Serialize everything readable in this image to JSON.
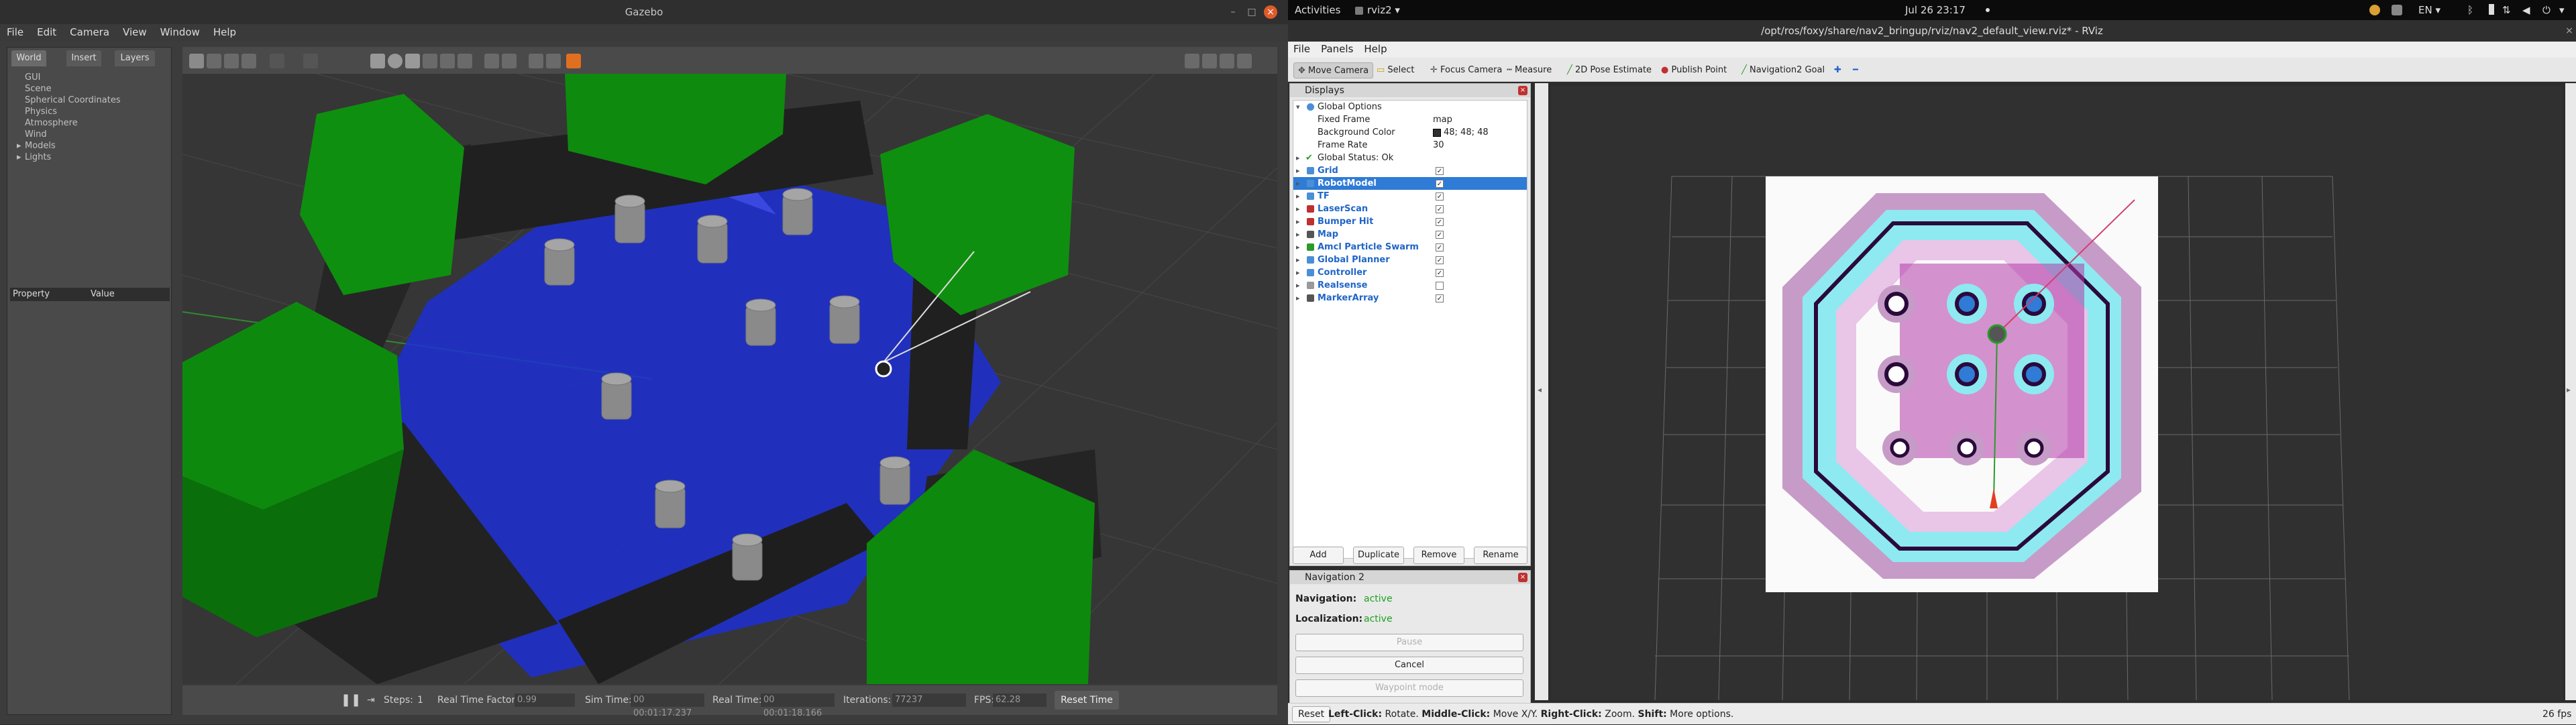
{
  "gazebo": {
    "title": "Gazebo",
    "menu": [
      "File",
      "Edit",
      "Camera",
      "View",
      "Window",
      "Help"
    ],
    "tabs": [
      "World",
      "Insert",
      "Layers"
    ],
    "tree": [
      "GUI",
      "Scene",
      "Spherical Coordinates",
      "Physics",
      "Atmosphere",
      "Wind",
      "Models",
      "Lights"
    ],
    "property_header": {
      "property": "Property",
      "value": "Value"
    },
    "bottom": {
      "steps_label": "Steps:",
      "steps_value": "1",
      "rtf_label": "Real Time Factor:",
      "rtf_value": "0.99",
      "sim_label": "Sim Time:",
      "sim_value": "00 00:01:17.237",
      "real_label": "Real Time:",
      "real_value": "00 00:01:18.166",
      "iter_label": "Iterations:",
      "iter_value": "77237",
      "fps_label": "FPS:",
      "fps_value": "62.28",
      "reset_label": "Reset Time"
    }
  },
  "topbar": {
    "activities": "Activities",
    "app": "rviz2 ▾",
    "clock": "Jul 26  23:17",
    "lang": "EN ▾"
  },
  "rviz": {
    "title": "/opt/ros/foxy/share/nav2_bringup/rviz/nav2_default_view.rviz* - RViz",
    "menu": [
      "File",
      "Panels",
      "Help"
    ],
    "tools": [
      "Move Camera",
      "Select",
      "Focus Camera",
      "Measure",
      "2D Pose Estimate",
      "Publish Point",
      "Navigation2 Goal"
    ],
    "displays_title": "Displays",
    "global_options": "Global Options",
    "fixed_frame": {
      "label": "Fixed Frame",
      "value": "map"
    },
    "bg_color": {
      "label": "Background Color",
      "value": "48; 48; 48"
    },
    "frame_rate": {
      "label": "Frame Rate",
      "value": "30"
    },
    "global_status": "Global Status: Ok",
    "plugins": [
      {
        "name": "Grid",
        "checked": true
      },
      {
        "name": "RobotModel",
        "checked": true
      },
      {
        "name": "TF",
        "checked": true
      },
      {
        "name": "LaserScan",
        "checked": true
      },
      {
        "name": "Bumper Hit",
        "checked": true
      },
      {
        "name": "Map",
        "checked": true
      },
      {
        "name": "Amcl Particle Swarm",
        "checked": true
      },
      {
        "name": "Global Planner",
        "checked": true
      },
      {
        "name": "Controller",
        "checked": true
      },
      {
        "name": "Realsense",
        "checked": false
      },
      {
        "name": "MarkerArray",
        "checked": true
      }
    ],
    "buttons": {
      "add": "Add",
      "duplicate": "Duplicate",
      "remove": "Remove",
      "rename": "Rename"
    },
    "nav2": {
      "title": "Navigation 2",
      "navigation_label": "Navigation:",
      "navigation_value": "active",
      "localization_label": "Localization:",
      "localization_value": "active",
      "pause": "Pause",
      "cancel": "Cancel",
      "waypoint": "Waypoint mode"
    },
    "status": {
      "reset": "Reset",
      "hint_left": "Left-Click:",
      "hint_left_t": " Rotate. ",
      "hint_mid": "Middle-Click:",
      "hint_mid_t": " Move X/Y. ",
      "hint_right": "Right-Click:",
      "hint_right_t": " Zoom. ",
      "hint_shift": "Shift:",
      "hint_shift_t": " More options.",
      "fps": "26 fps"
    },
    "colors": {
      "selection": "#2f7bd6",
      "plugin_text": "#2066c7",
      "active": "#21a021"
    }
  }
}
